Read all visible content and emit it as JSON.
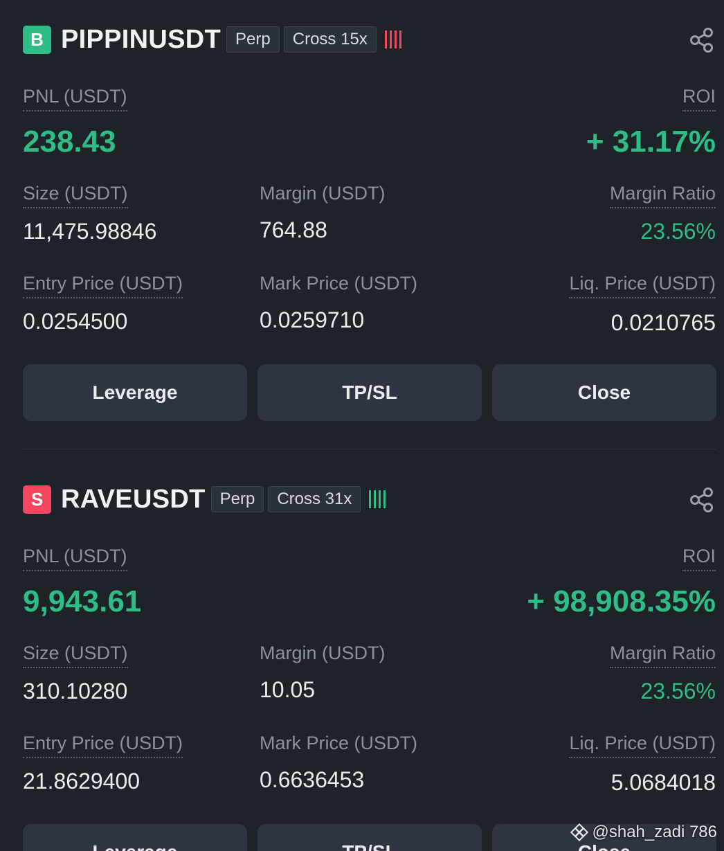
{
  "positions": [
    {
      "side_letter": "B",
      "side_color": "#2ebd85",
      "symbol": "PIPPINUSDT",
      "contract_type": "Perp",
      "margin_mode": "Cross 15x",
      "risk_color": "#f6465d",
      "pnl_label": "PNL (USDT)",
      "pnl_value": "238.43",
      "roi_label": "ROI",
      "roi_value": "+ 31.17%",
      "size_label": "Size (USDT)",
      "size_value": "11,475.98846",
      "margin_label": "Margin (USDT)",
      "margin_value": "764.88",
      "margin_ratio_label": "Margin Ratio",
      "margin_ratio_value": "23.56%",
      "entry_label": "Entry Price (USDT)",
      "entry_value": "0.0254500",
      "mark_label": "Mark Price (USDT)",
      "mark_value": "0.0259710",
      "liq_label": "Liq. Price (USDT)",
      "liq_value": "0.0210765",
      "buttons": {
        "leverage": "Leverage",
        "tpsl": "TP/SL",
        "close": "Close"
      }
    },
    {
      "side_letter": "S",
      "side_color": "#f6465d",
      "symbol": "RAVEUSDT",
      "contract_type": "Perp",
      "margin_mode": "Cross 31x",
      "risk_color": "#2ebd85",
      "pnl_label": "PNL (USDT)",
      "pnl_value": "9,943.61",
      "roi_label": "ROI",
      "roi_value": "+ 98,908.35%",
      "size_label": "Size (USDT)",
      "size_value": "310.10280",
      "margin_label": "Margin (USDT)",
      "margin_value": "10.05",
      "margin_ratio_label": "Margin Ratio",
      "margin_ratio_value": "23.56%",
      "entry_label": "Entry Price (USDT)",
      "entry_value": "21.8629400",
      "mark_label": "Mark Price (USDT)",
      "mark_value": "0.6636453",
      "liq_label": "Liq. Price (USDT)",
      "liq_value": "5.0684018",
      "buttons": {
        "leverage": "Leverage",
        "tpsl": "TP/SL",
        "close": "Close"
      }
    }
  ],
  "watermark": {
    "text": "@shah_zadi 786",
    "icon": "binance-diamond-icon"
  }
}
